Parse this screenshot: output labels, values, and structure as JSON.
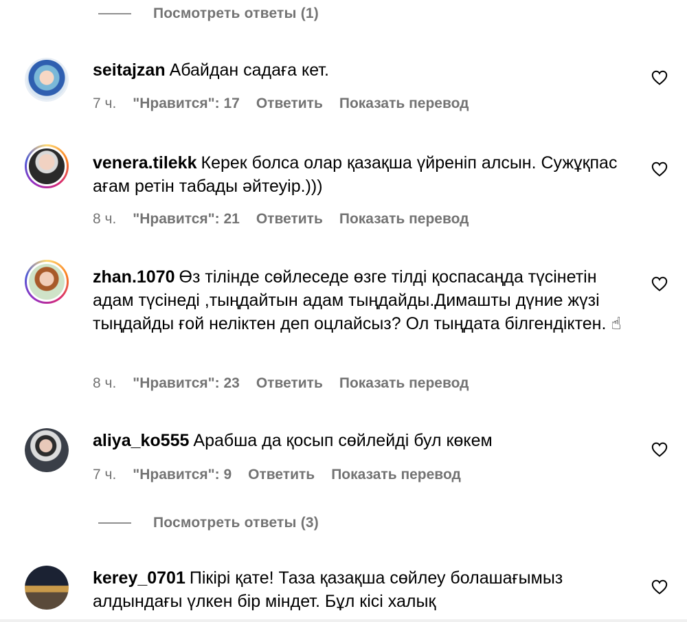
{
  "top_replies": {
    "label": "Посмотреть ответы (1)"
  },
  "comments": [
    {
      "username": "seitajzan",
      "text": "Абайдан садаға кет.",
      "time": "7 ч.",
      "likes": "\"Нравится\": 17",
      "reply": "Ответить",
      "translate": "Показать перевод"
    },
    {
      "username": "venera.tilekk",
      "text": "Керек болса олар қазақша үйреніп алсын. Сужұқпас ағам ретін табады әйтеуір.)))",
      "time": "8 ч.",
      "likes": "\"Нравится\": 21",
      "reply": "Ответить",
      "translate": "Показать перевод"
    },
    {
      "username": "zhan.1070",
      "text": "Өз тілінде сөйлеседе өзге тілді қоспасаңда түсінетін адам түсінеді ,тыңдайтын адам тыңдайды.Димашты дүние жүзі тыңдайды ғой неліктен деп оцлайсыз? Ол тыңдата білгендіктен. ☝",
      "time": "8 ч.",
      "likes": "\"Нравится\": 23",
      "reply": "Ответить",
      "translate": "Показать перевод"
    },
    {
      "username": "aliya_ko555",
      "text": "Арабша да қосып сөйлейді бул көкем",
      "time": "7 ч.",
      "likes": "\"Нравится\": 9",
      "reply": "Ответить",
      "translate": "Показать перевод"
    },
    {
      "username": "kerey_0701",
      "text": "Пікірі қате! Таза қазақша сөйлеу болашағымыз алдындағы үлкен бір міндет. Бұл кісі халық"
    }
  ],
  "mid_replies": {
    "label": "Посмотреть ответы (3)"
  }
}
